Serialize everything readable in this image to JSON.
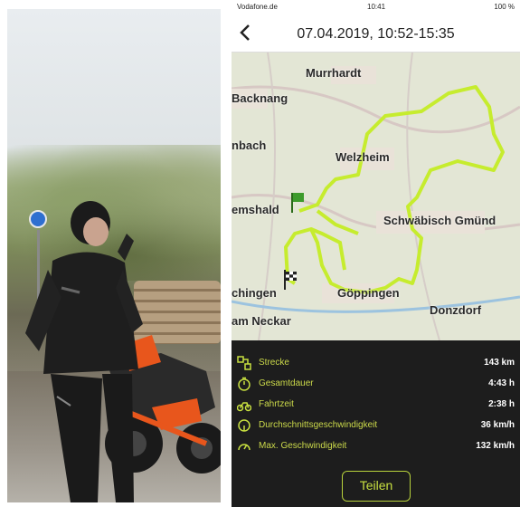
{
  "statusbar": {
    "carrier": "Vodafone.de",
    "time": "10:41",
    "battery": "100 %"
  },
  "header": {
    "title": "07.04.2019, 10:52-15:35"
  },
  "map": {
    "towns": [
      "Murrhardt",
      "Backnang",
      "nbach",
      "Welzheim",
      "emshald",
      "Schwäbisch Gmünd",
      "chingen",
      "Göppingen",
      "am Neckar",
      "Donzdorf"
    ]
  },
  "stats": [
    {
      "label": "Strecke",
      "value": "143 km",
      "icon": "route-icon"
    },
    {
      "label": "Gesamtdauer",
      "value": "4:43 h",
      "icon": "stopwatch-icon"
    },
    {
      "label": "Fahrtzeit",
      "value": "2:38 h",
      "icon": "motorbike-icon"
    },
    {
      "label": "Durchschnittsgeschwindigkeit",
      "value": "36 km/h",
      "icon": "average-speed-icon"
    },
    {
      "label": "Max. Geschwindigkeit",
      "value": "132 km/h",
      "icon": "speedometer-icon"
    }
  ],
  "share_label": "Teilen",
  "colors": {
    "route": "#c6ec2e",
    "accent": "#c8e040",
    "panel": "#1d1d1d"
  }
}
